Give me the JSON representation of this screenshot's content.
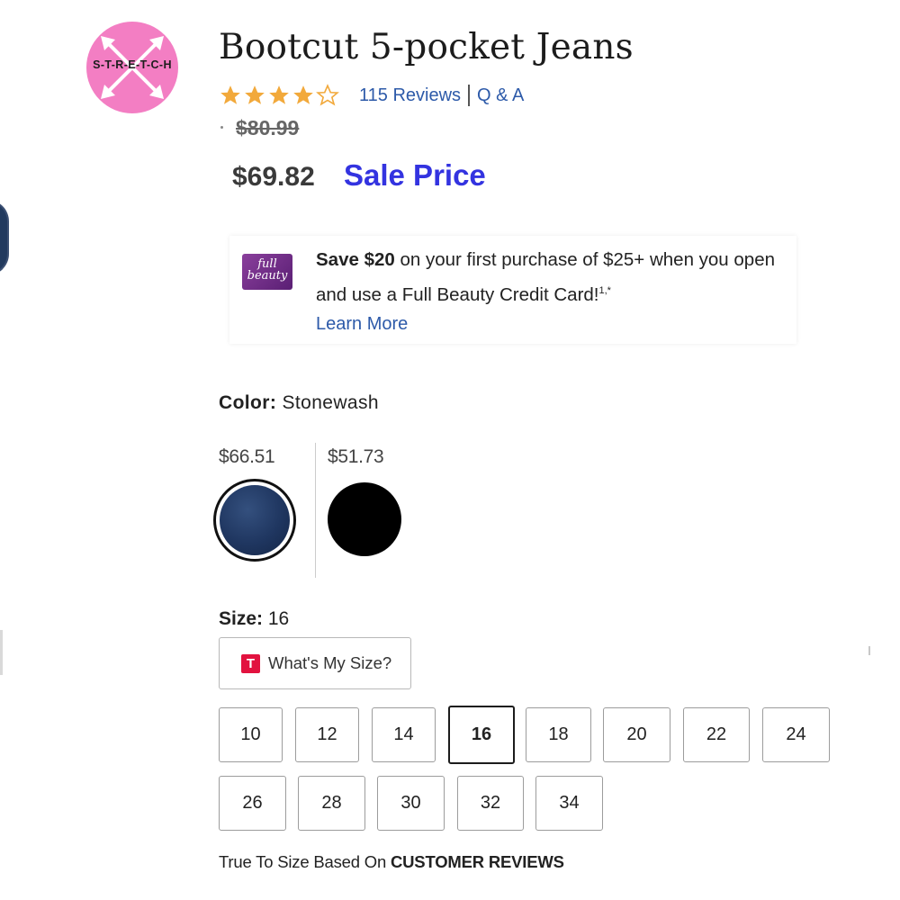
{
  "badge": {
    "text": "S-T-R-E-T-C-H",
    "color": "#f37ec3"
  },
  "product": {
    "title": "Bootcut 5-pocket Jeans"
  },
  "rating": {
    "stars": 4,
    "max_stars": 5,
    "reviews_text": "115 Reviews",
    "qa_text": "Q & A"
  },
  "price": {
    "original": "$80.99",
    "sale": "$69.82",
    "sale_label": "Sale Price",
    "sale_label_color": "#3333e0"
  },
  "promo": {
    "card_text": "full beauty",
    "bold": "Save $20",
    "text": " on your first purchase of $25+ when you open and use a Full Beauty Credit Card!",
    "superscript": "1,*",
    "link": "Learn More"
  },
  "color": {
    "label": "Color:",
    "value": "Stonewash",
    "swatches": [
      {
        "price": "$66.51",
        "name": "Stonewash",
        "selected": true
      },
      {
        "price": "$51.73",
        "name": "Black",
        "selected": false
      }
    ]
  },
  "size": {
    "label": "Size:",
    "value": "16",
    "whats_my_size_icon": "T",
    "whats_my_size": "What's My Size?",
    "options": [
      "10",
      "12",
      "14",
      "16",
      "18",
      "20",
      "22",
      "24",
      "26",
      "28",
      "30",
      "32",
      "34"
    ],
    "selected": "16"
  },
  "fit": {
    "prefix": "True To Size Based On ",
    "bold": "CUSTOMER REVIEWS"
  }
}
